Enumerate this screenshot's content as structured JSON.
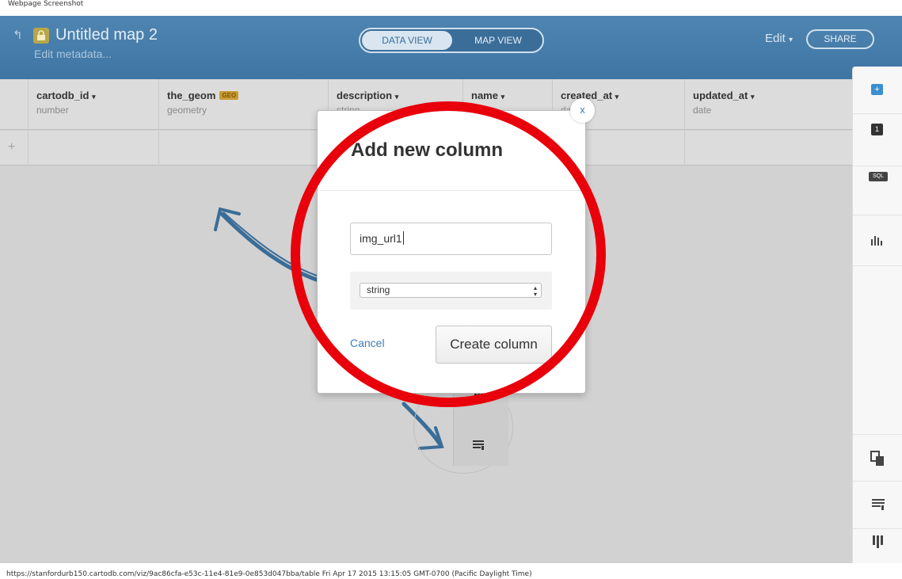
{
  "caption": "Webpage Screenshot",
  "footer": "https://stanfordurb150.cartodb.com/viz/9ac86cfa-e53c-11e4-81e9-0e853d047bba/table Fri Apr 17 2015 13:15:05 GMT-0700 (Pacific Daylight Time)",
  "header": {
    "title": "Untitled map 2",
    "subtitle": "Edit metadata...",
    "views": {
      "data": "DATA VIEW",
      "map": "MAP VIEW",
      "active": "data"
    },
    "edit_label": "Edit",
    "edit_caret": "▾",
    "share_label": "SHARE"
  },
  "table": {
    "columns": [
      {
        "name": "cartodb_id",
        "type": "number",
        "caret": "▾"
      },
      {
        "name": "the_geom",
        "type": "geometry",
        "badge": "GEO"
      },
      {
        "name": "description",
        "type": "string",
        "caret": "▾"
      },
      {
        "name": "name",
        "type": "string",
        "caret": "▾"
      },
      {
        "name": "created_at",
        "type": "date",
        "caret": "▾"
      },
      {
        "name": "updated_at",
        "type": "date",
        "caret": "▾"
      }
    ],
    "add_row_symbol": "+"
  },
  "modal": {
    "title": "Add new column",
    "close_label": "x",
    "name_value": "img_url1",
    "type_value": "string",
    "cancel_label": "Cancel",
    "create_label": "Create column"
  },
  "sidebar_icons": [
    "add-layer-icon",
    "layer-1-icon",
    "sql-icon",
    "chart-icon",
    "merge-icon",
    "add-row-icon",
    "add-column-icon"
  ],
  "sidebar_text": {
    "layer_number": "1",
    "sql": "SQL"
  },
  "colors": {
    "header": "#4a80ad",
    "highlight_ring": "#e8000b",
    "link": "#3e7db3"
  }
}
